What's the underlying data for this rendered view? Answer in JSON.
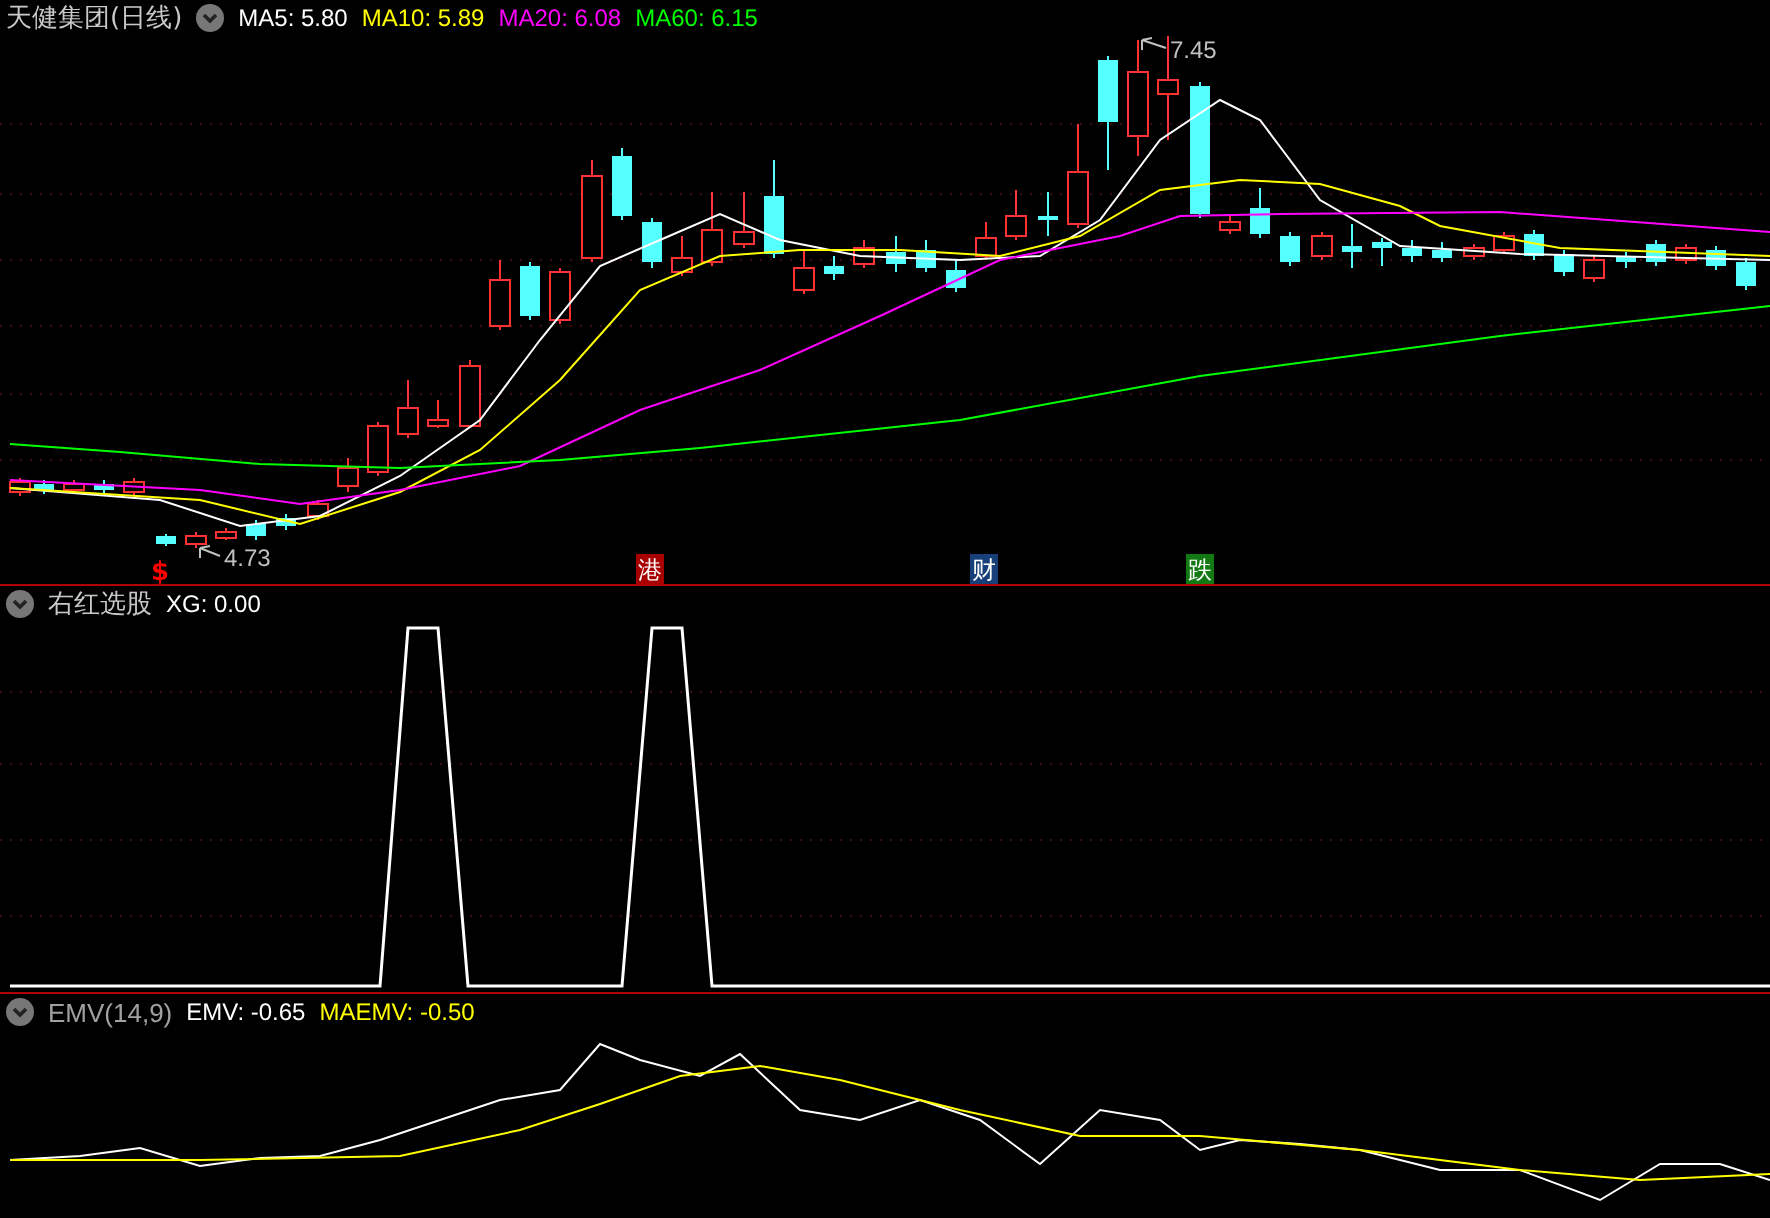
{
  "main_panel": {
    "title": "天健集团(日线)",
    "indicators": [
      {
        "label": "MA5: 5.80",
        "color": "#ffffff"
      },
      {
        "label": "MA10: 5.89",
        "color": "#ffff00"
      },
      {
        "label": "MA20: 6.08",
        "color": "#ff00ff"
      },
      {
        "label": "MA60: 6.15",
        "color": "#00ff00"
      }
    ],
    "price_labels": [
      {
        "text": "7.45"
      },
      {
        "text": "4.73"
      }
    ],
    "markers": [
      {
        "text": "$",
        "kind": "text",
        "color": "#ff0000"
      },
      {
        "text": "港",
        "kind": "badge",
        "color": "#a80000"
      },
      {
        "text": "财",
        "kind": "badge",
        "color": "#173f7a"
      },
      {
        "text": "跌",
        "kind": "badge",
        "color": "#137a13"
      }
    ]
  },
  "xg_panel": {
    "title": "右红选股",
    "indicators": [
      {
        "label": "XG: 0.00",
        "color": "#ffffff"
      }
    ]
  },
  "emv_panel": {
    "title": "EMV(14,9)",
    "indicators": [
      {
        "label": "EMV: -0.65",
        "color": "#ffffff"
      },
      {
        "label": "MAEMV: -0.50",
        "color": "#ffff00"
      }
    ]
  }
}
